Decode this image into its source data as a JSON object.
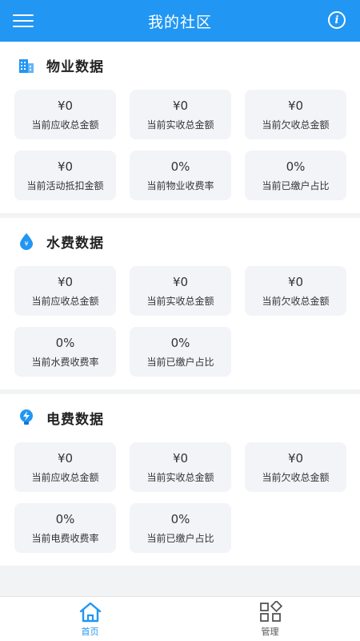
{
  "header": {
    "title": "我的社区"
  },
  "sections": [
    {
      "title": "物业数据",
      "icon": "building-icon",
      "cards": [
        {
          "value": "¥0",
          "label": "当前应收总金额"
        },
        {
          "value": "¥0",
          "label": "当前实收总金额"
        },
        {
          "value": "¥0",
          "label": "当前欠收总金额"
        },
        {
          "value": "¥0",
          "label": "当前活动抵扣金额"
        },
        {
          "value": "0%",
          "label": "当前物业收费率"
        },
        {
          "value": "0%",
          "label": "当前已缴户占比"
        }
      ]
    },
    {
      "title": "水费数据",
      "icon": "water-drop-icon",
      "cards": [
        {
          "value": "¥0",
          "label": "当前应收总金额"
        },
        {
          "value": "¥0",
          "label": "当前实收总金额"
        },
        {
          "value": "¥0",
          "label": "当前欠收总金额"
        },
        {
          "value": "0%",
          "label": "当前水费收费率"
        },
        {
          "value": "0%",
          "label": "当前已缴户占比"
        }
      ]
    },
    {
      "title": "电费数据",
      "icon": "lightning-bulb-icon",
      "cards": [
        {
          "value": "¥0",
          "label": "当前应收总金额"
        },
        {
          "value": "¥0",
          "label": "当前实收总金额"
        },
        {
          "value": "¥0",
          "label": "当前欠收总金额"
        },
        {
          "value": "0%",
          "label": "当前电费收费率"
        },
        {
          "value": "0%",
          "label": "当前已缴户占比"
        }
      ]
    }
  ],
  "tabbar": {
    "home_label": "首页",
    "manage_label": "管理"
  },
  "colors": {
    "primary": "#2196f3",
    "card_bg": "#f3f4f8"
  }
}
